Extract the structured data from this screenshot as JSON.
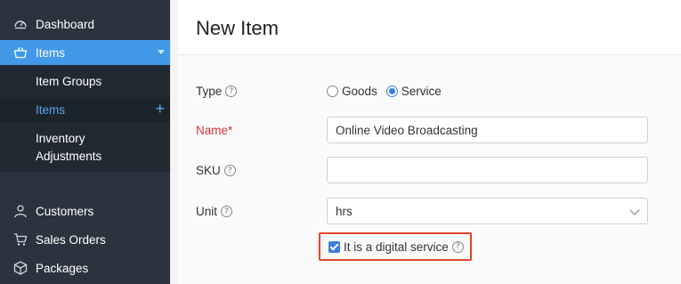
{
  "sidebar": {
    "items": [
      {
        "label": "Dashboard",
        "icon": "dashboard-icon"
      },
      {
        "label": "Items",
        "icon": "basket-icon"
      },
      {
        "label": "Item Groups"
      },
      {
        "label": "Items"
      },
      {
        "label": "Inventory Adjustments"
      },
      {
        "label": "Customers",
        "icon": "user-icon"
      },
      {
        "label": "Sales Orders",
        "icon": "cart-icon"
      },
      {
        "label": "Packages",
        "icon": "package-icon"
      }
    ],
    "add_symbol": "+",
    "inventory_line1": "Inventory",
    "inventory_line2": "Adjustments"
  },
  "header": {
    "title": "New Item"
  },
  "form": {
    "type_label": "Type",
    "type_options": [
      "Goods",
      "Service"
    ],
    "type_selected": "Service",
    "name_label": "Name*",
    "name_value": "Online Video Broadcasting",
    "sku_label": "SKU",
    "sku_value": "",
    "unit_label": "Unit",
    "unit_value": "hrs",
    "digital_label": "It is a digital service",
    "digital_checked": true,
    "help_symbol": "?"
  },
  "colors": {
    "sidebar_bg": "#2a343e",
    "active_bg": "#4199e8",
    "accent": "#3d7fd9",
    "required": "#d6303a",
    "highlight_border": "#e0452d"
  }
}
